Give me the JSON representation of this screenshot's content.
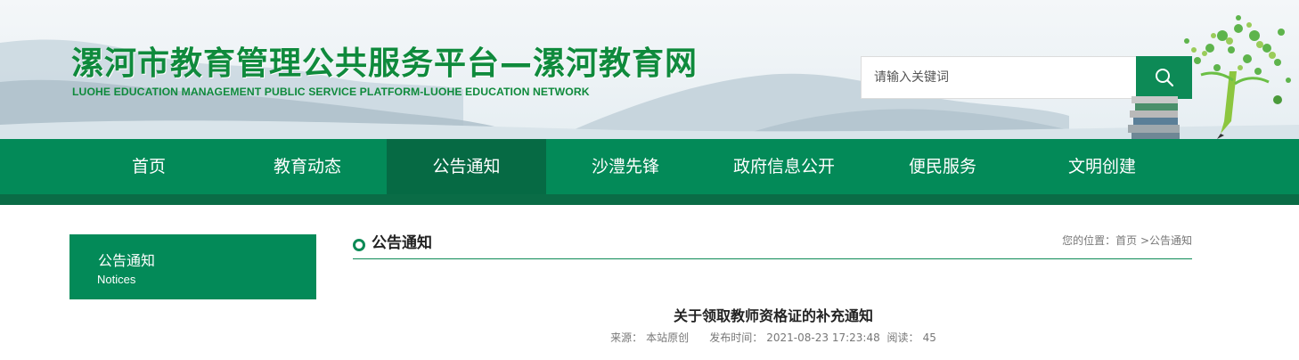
{
  "header": {
    "title": "漯河市教育管理公共服务平台—漯河教育网",
    "subtitle": "LUOHE EDUCATION MANAGEMENT PUBLIC SERVICE PLATFORM-LUOHE EDUCATION NETWORK",
    "search": {
      "placeholder": "请输入关键词",
      "button_icon": "search-icon"
    }
  },
  "nav": {
    "items": [
      {
        "label": "首页"
      },
      {
        "label": "教育动态"
      },
      {
        "label": "公告通知",
        "active": true
      },
      {
        "label": "沙澧先锋"
      },
      {
        "label": "政府信息公开"
      },
      {
        "label": "便民服务"
      },
      {
        "label": "文明创建"
      }
    ]
  },
  "sidebar": {
    "title": "公告通知",
    "subtitle": "Notices"
  },
  "content": {
    "section_title": "公告通知",
    "breadcrumb": "您的位置：首页 >公告通知",
    "article": {
      "title": "关于领取教师资格证的补充通知",
      "source_label": "来源：",
      "source": "本站原创",
      "publish_label": "发布时间：",
      "publish_time": "2021-08-23 17:23:48",
      "views_label": "阅读：",
      "views": "45"
    }
  },
  "colors": {
    "brand_green": "#038a58",
    "nav_active": "#066a44",
    "title_green": "#0f8a3c"
  }
}
